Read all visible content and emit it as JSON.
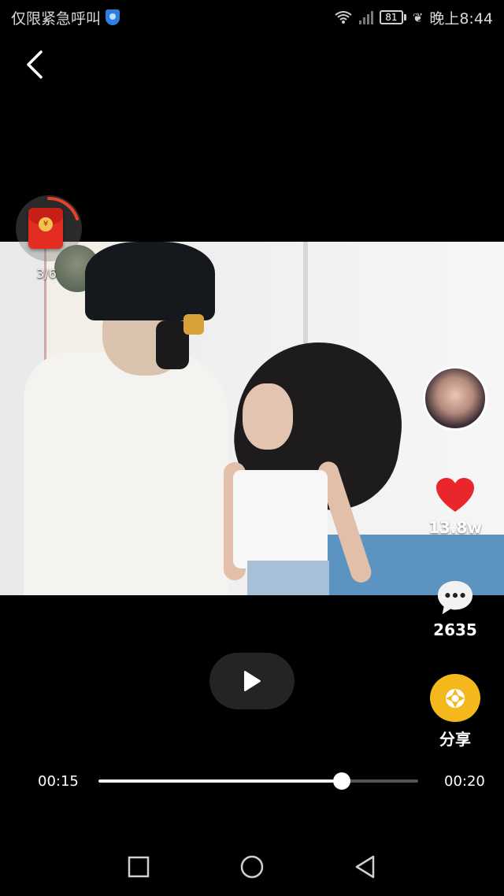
{
  "status_bar": {
    "carrier_text": "仅限紧急呼叫",
    "battery_level": "81",
    "time": "晚上8:44"
  },
  "video": {
    "progress_fraction": 0.76
  },
  "red_envelope": {
    "count": "3/6"
  },
  "actions": {
    "like_count": "13.8w",
    "comment_count": "2635",
    "share_label": "分享"
  },
  "player": {
    "current_time": "00:15",
    "total_time": "00:20"
  },
  "colors": {
    "like": "#e8262c",
    "share": "#f4b81c",
    "envelope": "#e32d23"
  },
  "icons": [
    "back-icon",
    "shield-icon",
    "wifi-icon",
    "signal-icon",
    "battery-icon",
    "leaf-icon",
    "red-envelope-icon",
    "heart-icon",
    "comment-icon",
    "share-icon",
    "play-icon",
    "nav-recents-icon",
    "nav-home-icon",
    "nav-back-icon"
  ]
}
